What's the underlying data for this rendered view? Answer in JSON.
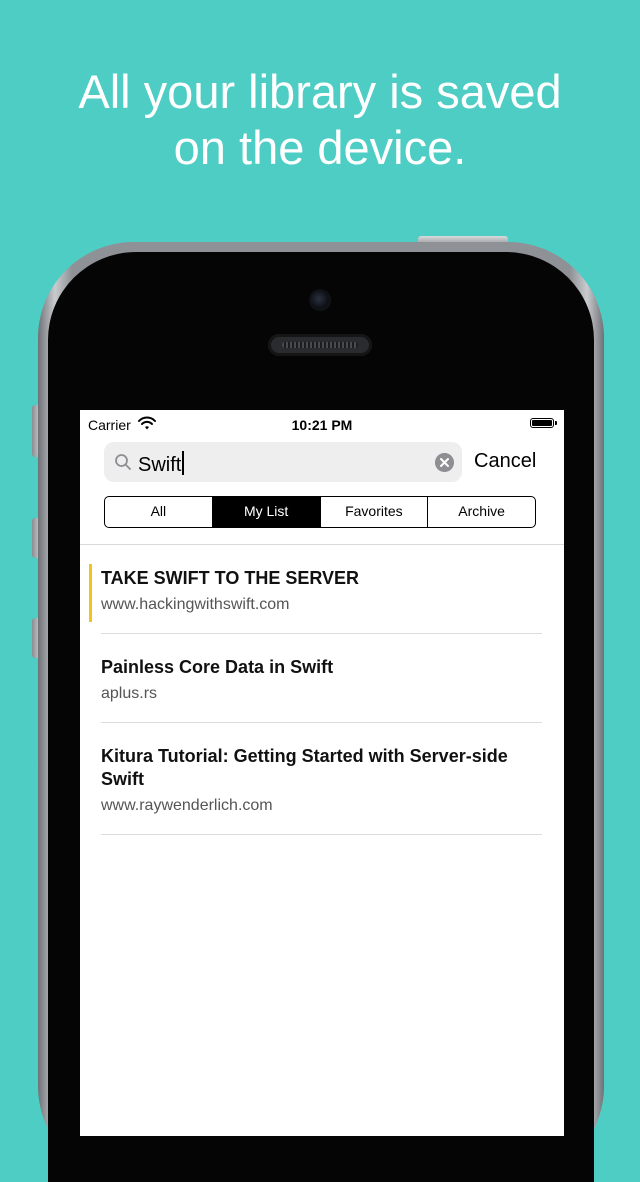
{
  "headline": {
    "line1": "All your library is saved",
    "line2": "on the device."
  },
  "status_bar": {
    "carrier": "Carrier",
    "time": "10:21 PM"
  },
  "search": {
    "value": "Swift",
    "cancel_label": "Cancel"
  },
  "tabs": [
    {
      "label": "All",
      "active": false
    },
    {
      "label": "My List",
      "active": true
    },
    {
      "label": "Favorites",
      "active": false
    },
    {
      "label": "Archive",
      "active": false
    }
  ],
  "items": [
    {
      "title": "TAKE SWIFT TO THE SERVER",
      "url": "www.hackingwithswift.com",
      "highlighted": true
    },
    {
      "title": "Painless Core Data in Swift",
      "url": "aplus.rs",
      "highlighted": false
    },
    {
      "title": "Kitura Tutorial: Getting Started with Server-side Swift",
      "url": "www.raywenderlich.com",
      "highlighted": false
    }
  ],
  "colors": {
    "background": "#4ecdc4",
    "accent": "#f0c419"
  }
}
